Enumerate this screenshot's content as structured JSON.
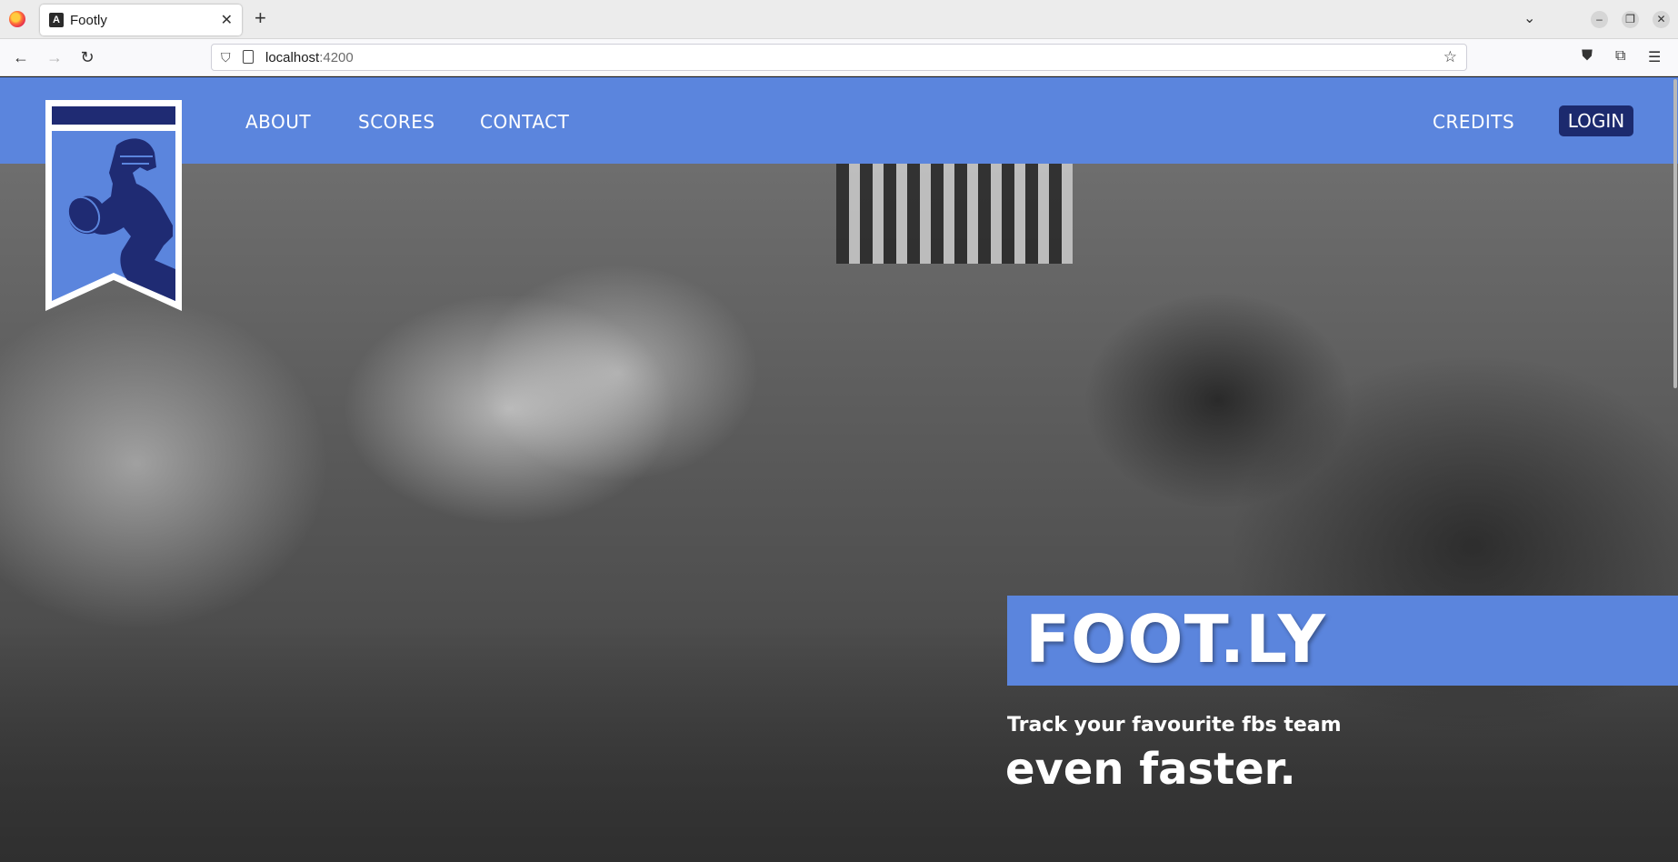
{
  "browser": {
    "tab_title": "Footly",
    "tab_favicon": "angular-icon",
    "new_tab_label": "+",
    "url_host": "localhost",
    "url_port": ":4200"
  },
  "header": {
    "nav": [
      "ABOUT",
      "SCORES",
      "CONTACT"
    ],
    "credits_label": "CREDITS",
    "login_label": "LOGIN"
  },
  "hero": {
    "title": "FOOT.LY",
    "tagline": "Track your favourite fbs team",
    "tagline_big": "even faster."
  },
  "colors": {
    "brand_blue": "#5b85dd",
    "login_navy": "#1c2a6e",
    "logo_navy": "#1f2b73"
  },
  "icons": [
    "firefox-icon",
    "back-icon",
    "forward-icon",
    "reload-icon",
    "shield-icon",
    "page-icon",
    "bookmark-star-icon",
    "pocket-icon",
    "extensions-icon",
    "menu-icon",
    "football-player-logo"
  ]
}
